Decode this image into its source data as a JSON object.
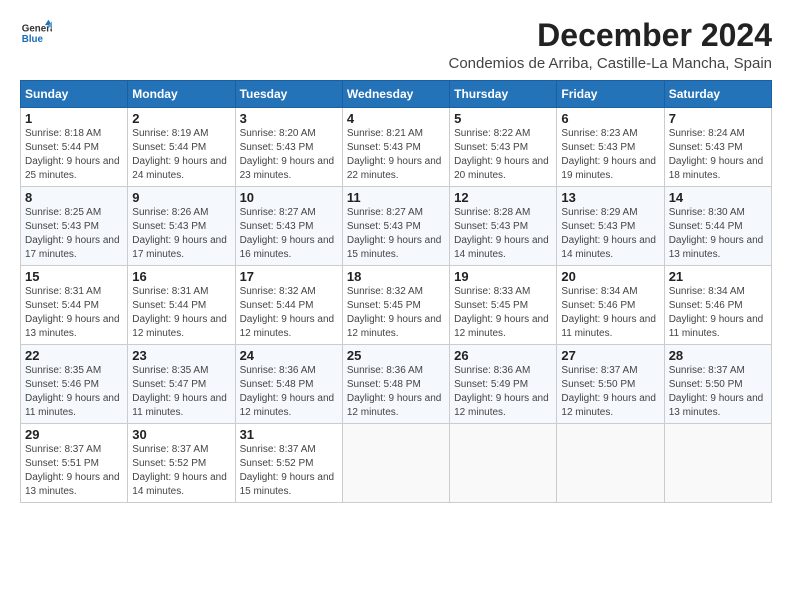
{
  "header": {
    "logo_line1": "General",
    "logo_line2": "Blue",
    "month_title": "December 2024",
    "location": "Condemios de Arriba, Castille-La Mancha, Spain"
  },
  "days_of_week": [
    "Sunday",
    "Monday",
    "Tuesday",
    "Wednesday",
    "Thursday",
    "Friday",
    "Saturday"
  ],
  "weeks": [
    [
      {
        "day": "1",
        "sunrise": "8:18 AM",
        "sunset": "5:44 PM",
        "daylight": "9 hours and 25 minutes."
      },
      {
        "day": "2",
        "sunrise": "8:19 AM",
        "sunset": "5:44 PM",
        "daylight": "9 hours and 24 minutes."
      },
      {
        "day": "3",
        "sunrise": "8:20 AM",
        "sunset": "5:43 PM",
        "daylight": "9 hours and 23 minutes."
      },
      {
        "day": "4",
        "sunrise": "8:21 AM",
        "sunset": "5:43 PM",
        "daylight": "9 hours and 22 minutes."
      },
      {
        "day": "5",
        "sunrise": "8:22 AM",
        "sunset": "5:43 PM",
        "daylight": "9 hours and 20 minutes."
      },
      {
        "day": "6",
        "sunrise": "8:23 AM",
        "sunset": "5:43 PM",
        "daylight": "9 hours and 19 minutes."
      },
      {
        "day": "7",
        "sunrise": "8:24 AM",
        "sunset": "5:43 PM",
        "daylight": "9 hours and 18 minutes."
      }
    ],
    [
      {
        "day": "8",
        "sunrise": "8:25 AM",
        "sunset": "5:43 PM",
        "daylight": "9 hours and 17 minutes."
      },
      {
        "day": "9",
        "sunrise": "8:26 AM",
        "sunset": "5:43 PM",
        "daylight": "9 hours and 17 minutes."
      },
      {
        "day": "10",
        "sunrise": "8:27 AM",
        "sunset": "5:43 PM",
        "daylight": "9 hours and 16 minutes."
      },
      {
        "day": "11",
        "sunrise": "8:27 AM",
        "sunset": "5:43 PM",
        "daylight": "9 hours and 15 minutes."
      },
      {
        "day": "12",
        "sunrise": "8:28 AM",
        "sunset": "5:43 PM",
        "daylight": "9 hours and 14 minutes."
      },
      {
        "day": "13",
        "sunrise": "8:29 AM",
        "sunset": "5:43 PM",
        "daylight": "9 hours and 14 minutes."
      },
      {
        "day": "14",
        "sunrise": "8:30 AM",
        "sunset": "5:44 PM",
        "daylight": "9 hours and 13 minutes."
      }
    ],
    [
      {
        "day": "15",
        "sunrise": "8:31 AM",
        "sunset": "5:44 PM",
        "daylight": "9 hours and 13 minutes."
      },
      {
        "day": "16",
        "sunrise": "8:31 AM",
        "sunset": "5:44 PM",
        "daylight": "9 hours and 12 minutes."
      },
      {
        "day": "17",
        "sunrise": "8:32 AM",
        "sunset": "5:44 PM",
        "daylight": "9 hours and 12 minutes."
      },
      {
        "day": "18",
        "sunrise": "8:32 AM",
        "sunset": "5:45 PM",
        "daylight": "9 hours and 12 minutes."
      },
      {
        "day": "19",
        "sunrise": "8:33 AM",
        "sunset": "5:45 PM",
        "daylight": "9 hours and 12 minutes."
      },
      {
        "day": "20",
        "sunrise": "8:34 AM",
        "sunset": "5:46 PM",
        "daylight": "9 hours and 11 minutes."
      },
      {
        "day": "21",
        "sunrise": "8:34 AM",
        "sunset": "5:46 PM",
        "daylight": "9 hours and 11 minutes."
      }
    ],
    [
      {
        "day": "22",
        "sunrise": "8:35 AM",
        "sunset": "5:46 PM",
        "daylight": "9 hours and 11 minutes."
      },
      {
        "day": "23",
        "sunrise": "8:35 AM",
        "sunset": "5:47 PM",
        "daylight": "9 hours and 11 minutes."
      },
      {
        "day": "24",
        "sunrise": "8:36 AM",
        "sunset": "5:48 PM",
        "daylight": "9 hours and 12 minutes."
      },
      {
        "day": "25",
        "sunrise": "8:36 AM",
        "sunset": "5:48 PM",
        "daylight": "9 hours and 12 minutes."
      },
      {
        "day": "26",
        "sunrise": "8:36 AM",
        "sunset": "5:49 PM",
        "daylight": "9 hours and 12 minutes."
      },
      {
        "day": "27",
        "sunrise": "8:37 AM",
        "sunset": "5:50 PM",
        "daylight": "9 hours and 12 minutes."
      },
      {
        "day": "28",
        "sunrise": "8:37 AM",
        "sunset": "5:50 PM",
        "daylight": "9 hours and 13 minutes."
      }
    ],
    [
      {
        "day": "29",
        "sunrise": "8:37 AM",
        "sunset": "5:51 PM",
        "daylight": "9 hours and 13 minutes."
      },
      {
        "day": "30",
        "sunrise": "8:37 AM",
        "sunset": "5:52 PM",
        "daylight": "9 hours and 14 minutes."
      },
      {
        "day": "31",
        "sunrise": "8:37 AM",
        "sunset": "5:52 PM",
        "daylight": "9 hours and 15 minutes."
      },
      null,
      null,
      null,
      null
    ]
  ]
}
